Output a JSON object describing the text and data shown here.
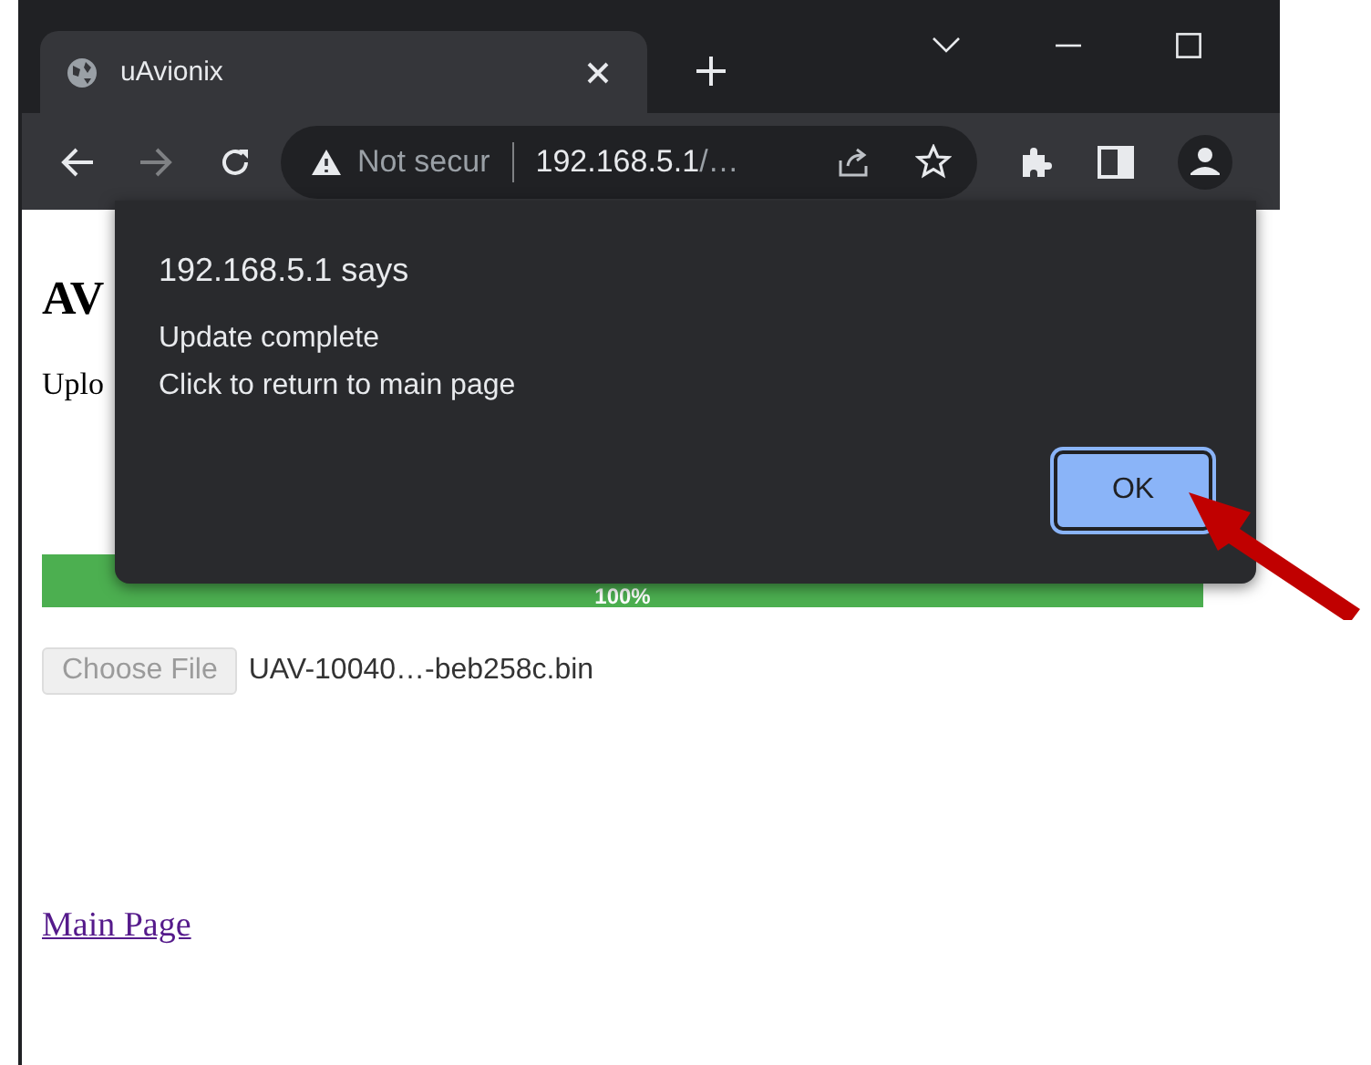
{
  "browser": {
    "tabs": [
      {
        "title": "uAvionix",
        "selected": true
      }
    ],
    "address": {
      "security_label": "Not secur",
      "host": "192.168.5.1",
      "path": "/…"
    }
  },
  "page": {
    "heading": "AV",
    "text": "Uplo",
    "progress": {
      "level": 1,
      "label": "100%"
    },
    "file_input": {
      "button": "Choose File",
      "disabled": true,
      "filename": "UAV-10040…-beb258c.bin"
    },
    "link": "Main Page"
  },
  "dialog": {
    "title": "192.168.5.1 says",
    "lines": [
      "Update complete",
      "Click to return to main page"
    ],
    "button": {
      "label": "OK",
      "focused": true
    }
  }
}
